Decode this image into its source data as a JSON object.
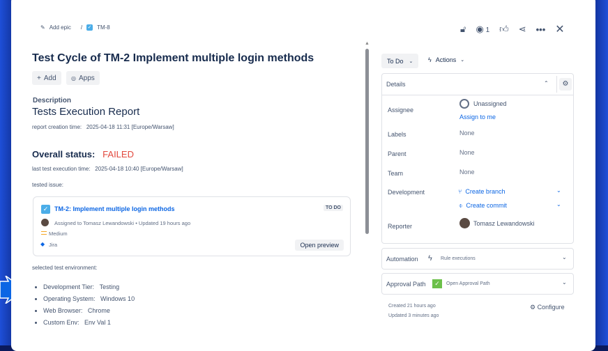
{
  "breadcrumb": {
    "add_epic": "Add epic",
    "separator": "/",
    "issue_key": "TM-8"
  },
  "header": {
    "watch_count": "1"
  },
  "title": "Test Cycle of TM-2 Implement multiple login methods",
  "toolbar": {
    "add": "Add",
    "apps": "Apps"
  },
  "description": {
    "label": "Description",
    "heading": "Tests Execution Report",
    "creation_label": "report creation time:",
    "creation_value": "2025-04-18 11:31 [Europe/Warsaw]",
    "status_label": "Overall status:",
    "status_value": "FAILED",
    "last_exec_label": "last test execution time:",
    "last_exec_value": "2025-04-18 10:40 [Europe/Warsaw]",
    "tested_issue_label": "tested issue:",
    "env_label": "selected test environment:",
    "env": [
      {
        "key": "Development Tier:",
        "value": "Testing"
      },
      {
        "key": "Operating System:",
        "value": "Windows 10"
      },
      {
        "key": "Web Browser:",
        "value": "Chrome"
      },
      {
        "key": "Custom Env:",
        "value": "Env Val 1"
      }
    ]
  },
  "issue_card": {
    "title": "TM-2: Implement multiple login methods",
    "status": "TO DO",
    "assigned": "Assigned to Tomasz Lewandowski",
    "dot": "•",
    "updated": "Updated 19 hours ago",
    "priority": "Medium",
    "source": "Jira",
    "open_preview": "Open preview"
  },
  "status_button": "To Do",
  "actions_button": "Actions",
  "details": {
    "title": "Details",
    "assignee_label": "Assignee",
    "assignee_value": "Unassigned",
    "assign_to_me": "Assign to me",
    "labels_label": "Labels",
    "labels_value": "None",
    "parent_label": "Parent",
    "parent_value": "None",
    "team_label": "Team",
    "team_value": "None",
    "development_label": "Development",
    "create_branch": "Create branch",
    "create_commit": "Create commit",
    "reporter_label": "Reporter",
    "reporter_value": "Tomasz Lewandowski"
  },
  "automation": {
    "title": "Automation",
    "sub": "Rule executions"
  },
  "approval": {
    "title": "Approval Path",
    "sub": "Open Approval Path"
  },
  "footer": {
    "created": "Created 21 hours ago",
    "updated": "Updated 3 minutes ago",
    "configure": "Configure"
  },
  "colors": {
    "failed": "#e2483d",
    "link": "#0c66e4",
    "background": "#0b1a5c"
  }
}
